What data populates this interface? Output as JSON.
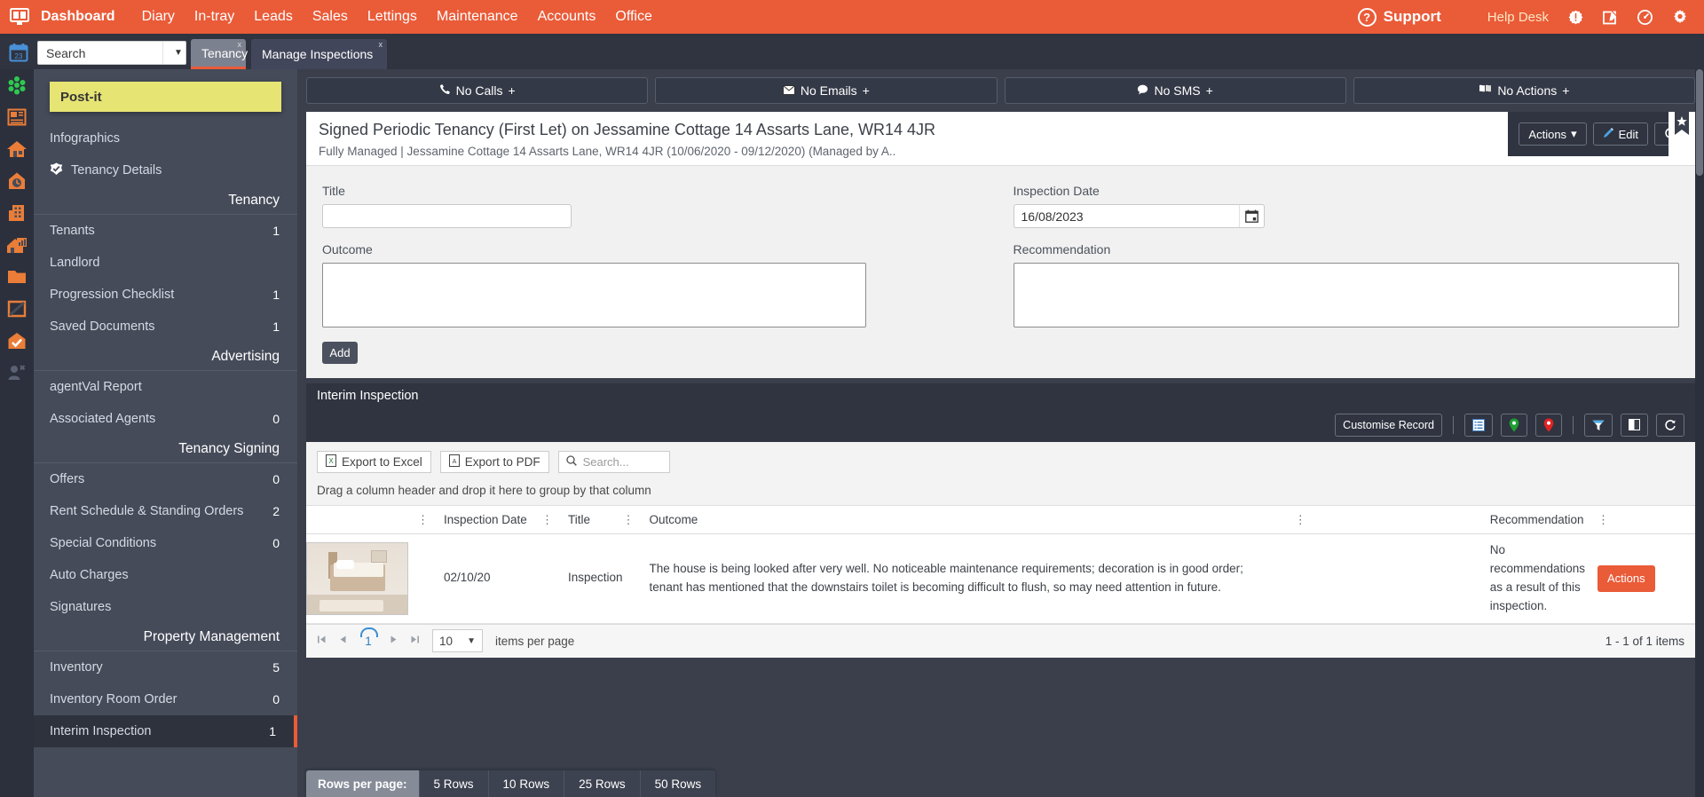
{
  "topbar": {
    "brand_icon": "dashboard-monitor-icon",
    "nav": [
      {
        "label": "Dashboard",
        "icon": "dashboard-icon"
      },
      {
        "label": "Diary",
        "icon": "diary-icon"
      },
      {
        "label": "In-tray",
        "icon": "intray-icon"
      },
      {
        "label": "Leads",
        "icon": "leads-icon"
      },
      {
        "label": "Sales",
        "icon": "sales-icon"
      },
      {
        "label": "Lettings",
        "icon": "lettings-icon"
      },
      {
        "label": "Maintenance",
        "icon": "maintenance-icon"
      },
      {
        "label": "Accounts",
        "icon": "accounts-icon"
      },
      {
        "label": "Office",
        "icon": "office-icon"
      }
    ],
    "support_label": "Support",
    "help_desk_label": "Help Desk",
    "icons": [
      "alert-badge-icon",
      "edit-note-icon",
      "speedometer-icon",
      "gear-icon"
    ],
    "accent_color": "#ea5b38"
  },
  "tabbar": {
    "calendar_icon": "calendar-icon",
    "search_value": "Search",
    "search_caret": "▼",
    "tabs": [
      {
        "label": "Tenancy",
        "close": "x",
        "active": true
      },
      {
        "label": "Manage Inspections",
        "close": "x",
        "active": false
      }
    ],
    "close_all": "×"
  },
  "rail": {
    "items": [
      "apps-grid-icon",
      "news-board-icon",
      "home-icon",
      "valuation-house-icon",
      "building-icon",
      "property-chart-icon",
      "folder-icon",
      "frame-icon",
      "house-check-icon",
      "people-tools-icon"
    ]
  },
  "sidebar": {
    "postit_label": "Post-it",
    "links_top": [
      {
        "label": "Infographics",
        "count": "",
        "icon": ""
      },
      {
        "label": "Tenancy Details",
        "count": "",
        "icon": "check-badge-icon"
      }
    ],
    "groups": [
      {
        "title": "Tenancy",
        "items": [
          {
            "label": "Tenants",
            "count": "1"
          },
          {
            "label": "Landlord",
            "count": ""
          },
          {
            "label": "Progression Checklist",
            "count": "1"
          },
          {
            "label": "Saved Documents",
            "count": "1"
          }
        ]
      },
      {
        "title": "Advertising",
        "items": [
          {
            "label": "agentVal Report",
            "count": ""
          },
          {
            "label": "Associated Agents",
            "count": "0"
          }
        ]
      },
      {
        "title": "Tenancy Signing",
        "items": [
          {
            "label": "Offers",
            "count": "0"
          },
          {
            "label": "Rent Schedule & Standing Orders",
            "count": "2"
          },
          {
            "label": "Special Conditions",
            "count": "0"
          },
          {
            "label": "Auto Charges",
            "count": ""
          },
          {
            "label": "Signatures",
            "count": ""
          }
        ]
      },
      {
        "title": "Property Management",
        "items": [
          {
            "label": "Inventory",
            "count": "5"
          },
          {
            "label": "Inventory Room Order",
            "count": "0"
          },
          {
            "label": "Interim Inspection",
            "count": "1",
            "selected": true
          }
        ]
      }
    ]
  },
  "comm_tabs": [
    {
      "label": "No Calls",
      "plus": "+",
      "icon": "phone-icon"
    },
    {
      "label": "No Emails",
      "plus": "+",
      "icon": "envelope-icon"
    },
    {
      "label": "No SMS",
      "plus": "+",
      "icon": "sms-bubble-icon"
    },
    {
      "label": "No Actions",
      "plus": "+",
      "icon": "actions-flag-icon"
    }
  ],
  "record": {
    "title": "Signed Periodic Tenancy (First Let) on Jessamine Cottage 14 Assarts Lane, WR14 4JR",
    "subtitle": "Fully Managed | Jessamine Cottage 14 Assarts Lane, WR14 4JR (10/06/2020 - 09/12/2020) (Managed by A..",
    "actions_label": "Actions",
    "actions_caret": "▾",
    "edit_label": "Edit",
    "refresh_icon": "refresh-icon",
    "bookmark_icon": "bookmark-star-icon"
  },
  "form": {
    "title_label": "Title",
    "title_value": "",
    "inspection_date_label": "Inspection Date",
    "inspection_date_value": "16/08/2023",
    "date_picker_icon": "calendar-picker-icon",
    "outcome_label": "Outcome",
    "outcome_value": "",
    "recommendation_label": "Recommendation",
    "recommendation_value": "",
    "add_label": "Add"
  },
  "grid": {
    "title": "Interim Inspection",
    "customise_label": "Customise Record",
    "tool_icons": [
      "list-view-icon",
      "map-pin-green-icon",
      "map-pin-red-icon",
      "filter-icon",
      "copy-icon",
      "refresh-icon"
    ],
    "export_excel": "Export to Excel",
    "export_pdf": "Export to PDF",
    "search_placeholder": "Search...",
    "search_icon": "search-icon",
    "group_hint": "Drag a column header and drop it here to group by that column",
    "columns": [
      "",
      "Inspection Date",
      "Title",
      "Outcome",
      "Recommendation"
    ],
    "rows": [
      {
        "thumbnail": "bedroom-photo-thumbnail",
        "inspection_date": "02/10/20",
        "title": "Inspection",
        "outcome": "The house is being looked after very well. No noticeable maintenance requirements; decoration is in good order; tenant has mentioned that the downstairs toilet is becoming difficult to flush, so may need attention in future.",
        "recommendation": "No recommendations as a result of this inspection.",
        "action_label": "Actions"
      }
    ],
    "pager": {
      "first_icon": "⏮",
      "prev_icon": "◀",
      "page": "1",
      "next_icon": "▶",
      "last_icon": "⏭",
      "page_size": "10",
      "page_size_caret": "▼",
      "items_per_page_label": "items per page",
      "range_label": "1 - 1 of 1 items"
    }
  },
  "rows_per_page_bar": {
    "label": "Rows per page:",
    "options": [
      "5 Rows",
      "10 Rows",
      "25 Rows",
      "50 Rows"
    ]
  }
}
